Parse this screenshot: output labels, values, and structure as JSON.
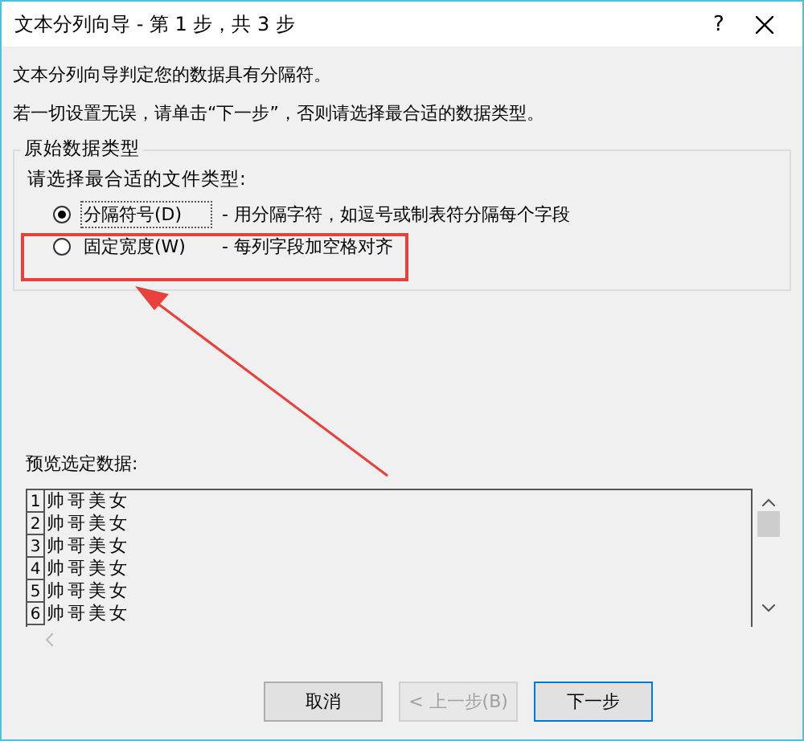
{
  "window": {
    "title": "文本分列向导 - 第 1 步，共 3 步",
    "help": "?"
  },
  "intro": [
    "文本分列向导判定您的数据具有分隔符。",
    "若一切设置无误，请单击“下一步”，否则请选择最合适的数据类型。"
  ],
  "group": {
    "legend": "原始数据类型",
    "prompt": "请选择最合适的文件类型:",
    "options": [
      {
        "label": "分隔符号(D)",
        "description": "- 用分隔字符，如逗号或制表符分隔每个字段",
        "selected": true
      },
      {
        "label": "固定宽度(W)",
        "description": "- 每列字段加空格对齐",
        "selected": false
      }
    ]
  },
  "preview": {
    "label": "预览选定数据:",
    "rows": [
      {
        "number": "1",
        "text": "帅哥美女"
      },
      {
        "number": "2",
        "text": "帅哥美女"
      },
      {
        "number": "3",
        "text": "帅哥美女"
      },
      {
        "number": "4",
        "text": "帅哥美女"
      },
      {
        "number": "5",
        "text": "帅哥美女"
      },
      {
        "number": "6",
        "text": "帅哥美女"
      }
    ]
  },
  "buttons": [
    {
      "label": "取消",
      "disabled": false,
      "primary": false
    },
    {
      "label": "< 上一步(B)",
      "disabled": true,
      "primary": false
    },
    {
      "label": "下一步",
      "disabled": false,
      "primary": true
    }
  ]
}
